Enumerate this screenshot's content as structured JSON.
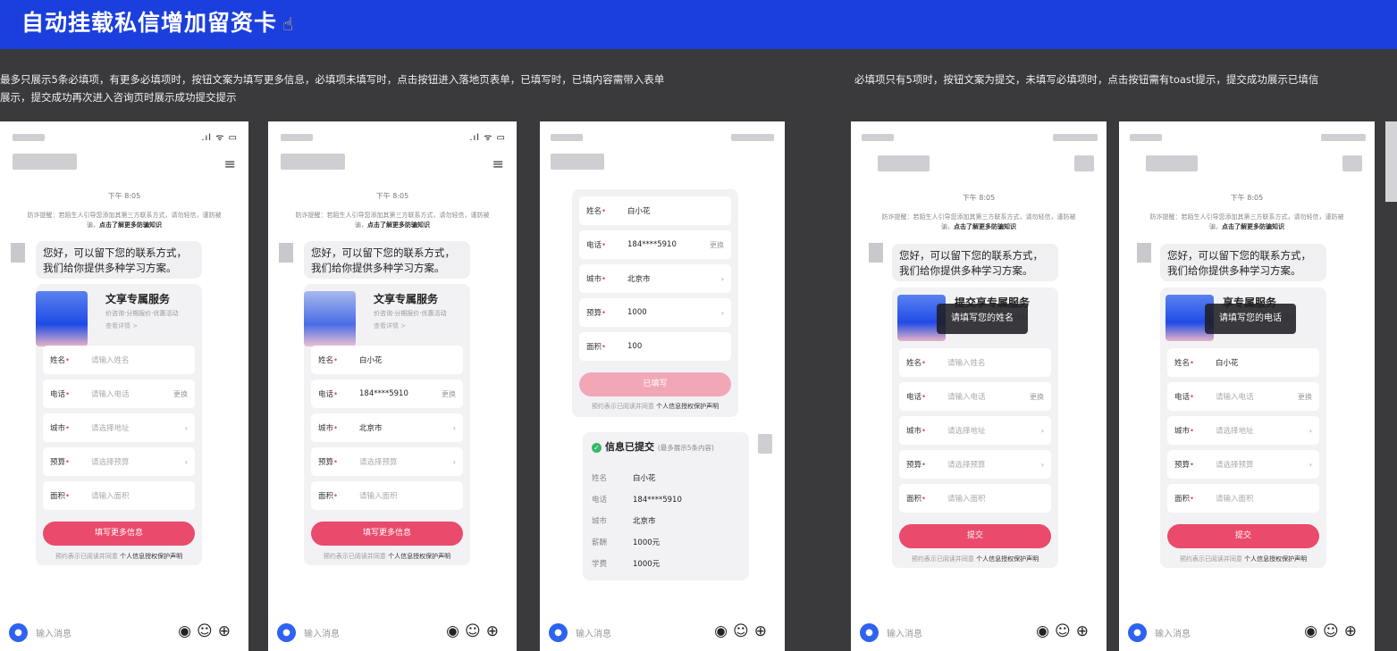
{
  "banner": {
    "title": "自动挂载私信增加留资卡",
    "icon": "pointing-hand-icon"
  },
  "descriptions": {
    "left_line1": "最多只展示5条必填项，有更多必填项时，按钮文案为填写更多信息，必填项未填写时，点击按钮进入落地页表单，已填写时，已填内容需带入表单",
    "left_line2": "展示，提交成功再次进入咨询页时展示成功提交提示",
    "right": "必填项只有5项时，按钮文案为提交，未填写必填项时，点击按钮需有toast提示，提交成功展示已填信"
  },
  "chat": {
    "time": "下午 8:05",
    "tip_text": "防诈提醒：若陌生人引导您添加其第三方联系方式，请勿轻信，谨防被骗，",
    "tip_link": "点击了解更多防骗知识",
    "greeting_line1": "您好，可以留下您的联系方式，",
    "greeting_line2": "我们给你提供多种学习方案。"
  },
  "service": {
    "title": "享专属服务",
    "title_prefixed": "文享专属服务",
    "title_submit": "提交享专属服务",
    "subtitle": "价咨询·分期报价·优惠活动",
    "link": "查看详情 >"
  },
  "form": {
    "name_label": "姓名",
    "phone_label": "电话",
    "city_label": "城市",
    "budget_label": "预算",
    "area_label": "面积",
    "name_ph": "请输入姓名",
    "phone_ph": "请输入电话",
    "city_ph": "请选择地址",
    "budget_ph": "请选择预算",
    "area_ph": "请输入面积",
    "change": "更换",
    "arrow": "›",
    "required": "•",
    "name_val": "白小花",
    "phone_val": "184****5910",
    "city_val": "北京市",
    "budget_val": "1000",
    "area_val": "100"
  },
  "buttons": {
    "more": "填写更多信息",
    "filled": "已填写",
    "submit": "提交"
  },
  "agree": {
    "prefix": "预约表示已阅读并同意",
    "link": "个人信息授权保护声明"
  },
  "submitted": {
    "title": "信息已提交",
    "note": "(最多展示5条内容)",
    "rows": [
      {
        "k": "姓名",
        "v": "白小花"
      },
      {
        "k": "电话",
        "v": "184****5910"
      },
      {
        "k": "城市",
        "v": "北京市"
      },
      {
        "k": "薪酬",
        "v": "1000元"
      },
      {
        "k": "学费",
        "v": "1000元"
      }
    ]
  },
  "toasts": {
    "name": "请填写您的姓名",
    "phone": "请填写您的电话"
  },
  "inputbar": {
    "placeholder": "输入消息",
    "camera_icon": "camera-icon",
    "voice_icon": "voice-icon",
    "emoji_icon": "emoji-icon",
    "plus_icon": "plus-icon"
  },
  "status": {
    "icons": ".ıl ᯤ ▭"
  },
  "colors": {
    "banner": "#1b3fdc",
    "accent": "#ea4a6b",
    "accent_light": "#f2a7b7",
    "camera": "#2e62f0",
    "success": "#34b96a"
  }
}
